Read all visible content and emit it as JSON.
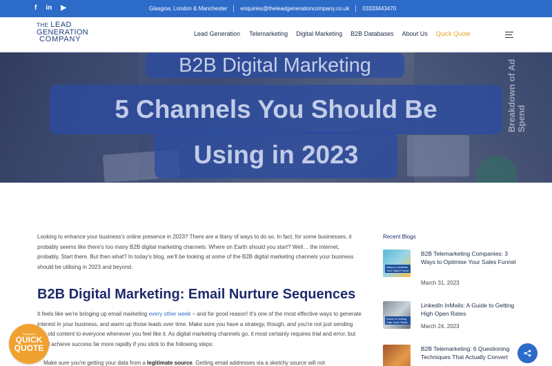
{
  "topbar": {
    "social": [
      "f",
      "in",
      "▶"
    ],
    "locations": "Glasgow, London & Manchester",
    "email": "enquiries@theleadgenerationcompany.co.uk",
    "phone": "03333443470"
  },
  "logo": {
    "line1a": "THE ",
    "line1b": "LEAD",
    "line2": "GENERATION",
    "line3": "COMPANY"
  },
  "nav": {
    "items": [
      "Lead Generation",
      "Telemarketing",
      "Digital Marketing",
      "B2B Databases",
      "About Us"
    ],
    "cta": "Quick Quote"
  },
  "hero": {
    "kicker": "B2B Digital Marketing",
    "title_line1": "5 Channels You Should Be",
    "title_line2": "Using in 2023",
    "side_text": "Breakdown of Ad Spend"
  },
  "article": {
    "intro": "Looking to enhance your business's online presence in 2023? There are a litany of ways to do so. In fact, for some businesses, it probably seems like there's too many B2B digital marketing channels. Where on Earth should you start? Well… the internet, probably. Start there. But then what? In today's blog, we'll be looking at some of the B2B digital marketing channels your business should be utilising in 2023 and beyond.",
    "heading": "B2B Digital Marketing: Email Nurture Sequences",
    "para_a": "It feels like we're bringing up email marketing ",
    "para_link": "every other week",
    "para_b": " – and for good reason! It's one of the most effective ways to generate interest in your business, and warm up those leads over time. Make sure you have a strategy, though, and you're not just sending any old content to everyone whenever you feel like it. As digital marketing channels go, it most certainly requires trial and error, but you'll achieve success far more rapidly if you stick to the following steps:",
    "bullet_a": "Make sure you're getting your data from a ",
    "bullet_bold": "legitimate source",
    "bullet_b": ". Getting email addresses via a sketchy source will not"
  },
  "sidebar": {
    "title": "Recent Blogs",
    "posts": [
      {
        "title": "B2B Telemarketing Companies: 3 Ways to Optimise Your Sales Funnel",
        "date": "March 31, 2023",
        "thumb_text": "Ways to Optimise Your Sales Funnel"
      },
      {
        "title": "LinkedIn InMails: A Guide to Getting High Open Rates",
        "date": "March 24, 2023",
        "thumb_text": "Guide to Getting High Open Rates"
      },
      {
        "title": "B2B Telemarketing: 6 Questioning Techniques That Actually Convert",
        "date": "",
        "thumb_text": ""
      }
    ]
  },
  "widgets": {
    "quote_small": "Request a",
    "quote_line1": "QUICK",
    "quote_line2": "QUOTE",
    "share_icon": "share-icon"
  }
}
